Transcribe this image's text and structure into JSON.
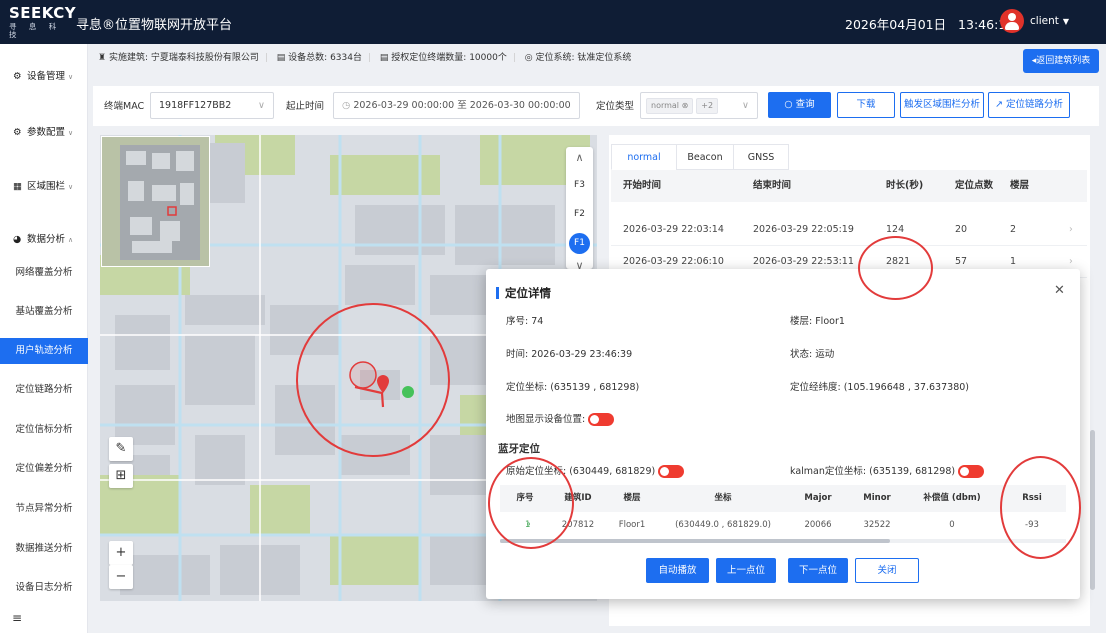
{
  "header": {
    "logo_main": "SEEKCY",
    "logo_sub": "寻 息 科 技",
    "app_title": "寻息®位置物联网开放平台",
    "date": "2026年04月01日",
    "time": "13:46:15",
    "user": "client"
  },
  "sidebar": {
    "groups": [
      {
        "icon": "gear-icon",
        "label": "设备管理"
      },
      {
        "icon": "settings-icon",
        "label": "参数配置"
      },
      {
        "icon": "grid-icon",
        "label": "区域围栏"
      },
      {
        "icon": "pie-chart-icon",
        "label": "数据分析"
      }
    ],
    "items": [
      "网络覆盖分析",
      "基站覆盖分析",
      "用户轨迹分析",
      "定位链路分析",
      "定位信标分析",
      "定位偏差分析",
      "节点异常分析",
      "数据推送分析",
      "设备日志分析"
    ],
    "active_item": "用户轨迹分析"
  },
  "infobar": {
    "building": "实施建筑: 宁夏瑞泰科技股份有限公司",
    "devices": "设备总数: 6334台",
    "licensed": "授权定位终端数量: 10000个",
    "system": "定位系统: 钛准定位系统",
    "back_button": "返回建筑列表"
  },
  "filter": {
    "mac_label": "终端MAC",
    "mac_value": "1918FF127BB2",
    "time_label": "起止时间",
    "time_value": "2026-03-29 00:00:00 至 2026-03-30 00:00:00",
    "type_label": "定位类型",
    "type_tag": "normal",
    "type_more": "+2",
    "query_button": "查询",
    "download_button": "下载",
    "fence_button": "触发区域围栏分析",
    "link_button": "定位链路分析"
  },
  "map": {
    "floors": [
      "F3",
      "F2",
      "F1"
    ],
    "active_floor": "F1",
    "zoom_in": "+",
    "zoom_out": "−"
  },
  "records": {
    "tabs": [
      "normal",
      "Beacon",
      "GNSS"
    ],
    "active_tab": "normal",
    "columns": [
      "开始时间",
      "结束时间",
      "时长(秒)",
      "定位点数",
      "楼层"
    ],
    "rows": [
      {
        "start": "2026-03-29 22:03:14",
        "end": "2026-03-29 22:05:19",
        "duration": "124",
        "points": "20",
        "floor": "2"
      },
      {
        "start": "2026-03-29 22:06:10",
        "end": "2026-03-29 22:53:11",
        "duration": "2821",
        "points": "57",
        "floor": "1"
      }
    ]
  },
  "detail": {
    "title": "定位详情",
    "seq": "序号: 74",
    "floor": "楼层: Floor1",
    "time": "时间: 2026-03-29 23:46:39",
    "status": "状态: 运动",
    "coord": "定位坐标: (635139 , 681298)",
    "lnglat": "定位经纬度: (105.196648 , 37.637380)",
    "show_device": "地图显示设备位置:",
    "ble_title": "蓝牙定位",
    "raw_coord": "原始定位坐标: (630449, 681829)",
    "kalman_coord": "kalman定位坐标: (635139, 681298)",
    "columns": [
      "序号",
      "建筑ID",
      "楼层",
      "坐标",
      "Major",
      "Minor",
      "补偿值 (dbm)",
      "Rssi"
    ],
    "row": {
      "seq": "1",
      "building": "207812",
      "floor": "Floor1",
      "coord": "(630449.0 , 681829.0)",
      "major": "20066",
      "minor": "32522",
      "comp": "0",
      "rssi": "-93"
    },
    "buttons": {
      "autoplay": "自动播放",
      "prev": "上一点位",
      "next": "下一点位",
      "close": "关闭"
    }
  },
  "colors": {
    "accent": "#1d6ef0",
    "header_bg": "#0f1d35",
    "toggle_on": "#ef3b30",
    "annotation_ring": "#e23b3b"
  }
}
